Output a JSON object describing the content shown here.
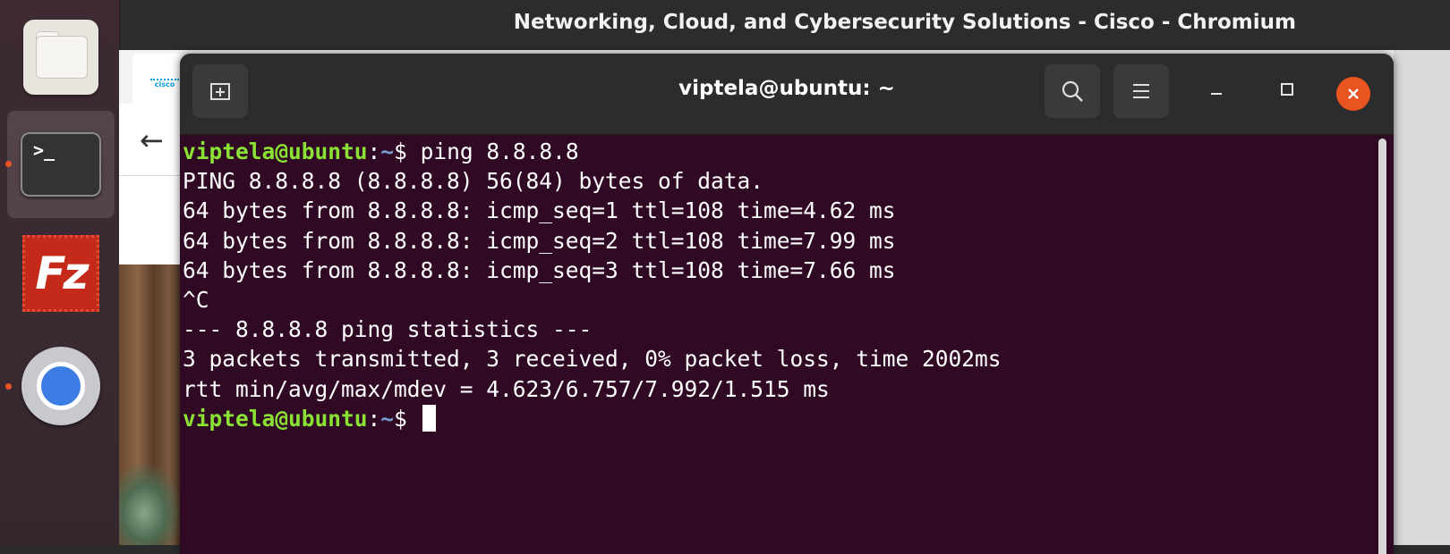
{
  "topbar": {
    "window_title": "Networking, Cloud, and Cybersecurity Solutions - Cisco - Chromium"
  },
  "dock": {
    "items": [
      {
        "name": "Files",
        "icon": "files-icon",
        "running": false
      },
      {
        "name": "Terminal",
        "icon": "terminal-icon",
        "running": true,
        "active": true
      },
      {
        "name": "FileZilla",
        "icon": "filezilla-icon",
        "icon_text": "Fz",
        "running": false
      },
      {
        "name": "Chromium",
        "icon": "chromium-icon",
        "running": true
      }
    ]
  },
  "browser": {
    "tab_favicon": "cisco-logo",
    "favicon_text": "cisco",
    "back_icon": "arrow-left-icon"
  },
  "terminal": {
    "title": "viptela@ubuntu: ~",
    "icons": {
      "new_tab": "new-tab-icon",
      "search": "search-icon",
      "menu": "hamburger-menu-icon",
      "minimize": "minimize-icon",
      "maximize": "maximize-icon",
      "close": "close-icon"
    },
    "prompt": {
      "user_host": "viptela@ubuntu",
      "separator": ":",
      "path": "~",
      "symbol": "$ "
    },
    "command": "ping 8.8.8.8",
    "output": [
      "PING 8.8.8.8 (8.8.8.8) 56(84) bytes of data.",
      "64 bytes from 8.8.8.8: icmp_seq=1 ttl=108 time=4.62 ms",
      "64 bytes from 8.8.8.8: icmp_seq=2 ttl=108 time=7.99 ms",
      "64 bytes from 8.8.8.8: icmp_seq=3 ttl=108 time=7.66 ms",
      "^C",
      "--- 8.8.8.8 ping statistics ---",
      "3 packets transmitted, 3 received, 0% packet loss, time 2002ms",
      "rtt min/avg/max/mdev = 4.623/6.757/7.992/1.515 ms"
    ],
    "colors": {
      "background": "#300a24",
      "user_host": "#8ae234",
      "path": "#729fcf",
      "text": "#ffffff",
      "close_button": "#e95420"
    }
  }
}
